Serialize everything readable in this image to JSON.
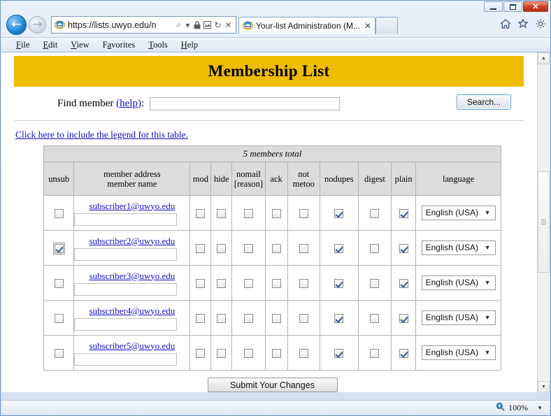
{
  "window": {
    "controls": {
      "minimize": "—",
      "maximize": "□",
      "close": "✕"
    }
  },
  "browser": {
    "back_icon": "←",
    "forward_icon": "→",
    "address": {
      "url": "https://lists.uwyo.edu/n",
      "favicon": "ie-logo-icon",
      "icons": [
        "search-icon",
        "dropdown-arrow-icon",
        "lock-icon",
        "compatibility-view-icon",
        "refresh-icon",
        "stop-icon"
      ],
      "search_glyph": "⌕",
      "dropdown_glyph": "▾",
      "lock_glyph": "🔒",
      "compat_glyph": "▩",
      "refresh_glyph": "↻",
      "stop_glyph": "✕"
    },
    "tabs": [
      {
        "title": "Your-list Administration (M...",
        "close_glyph": "✕",
        "active": true
      }
    ],
    "toolbar_icons": {
      "home_glyph": "⌂",
      "favorites_glyph": "★",
      "settings_glyph": "✿"
    },
    "menu": [
      {
        "accel": "F",
        "rest": "ile"
      },
      {
        "accel": "E",
        "rest": "dit"
      },
      {
        "accel": "V",
        "rest": "iew"
      },
      {
        "pre": "F",
        "accel": "a",
        "rest": "vorites"
      },
      {
        "pre": "",
        "accel": "T",
        "rest": "ools"
      },
      {
        "accel": "H",
        "rest": "elp"
      }
    ],
    "menu_labels": [
      "File",
      "Edit",
      "View",
      "Favorites",
      "Tools",
      "Help"
    ],
    "scrollbar": {
      "up_glyph": "▲",
      "down_glyph": "▼"
    },
    "status": {
      "zoom_level": "100%",
      "zoom_icon": "search-plus-icon",
      "zoom_glyph": "⊕",
      "caret": "▼"
    }
  },
  "page": {
    "banner_title": "Membership List",
    "banner_color": "#F0BC00",
    "find": {
      "label_prefix": "Find member ",
      "help_link": "(help)",
      "label_suffix": ":",
      "input_value": "",
      "search_button": "Search..."
    },
    "legend_link": "Click here to include the legend for this table.",
    "table": {
      "total_text": "5 members total",
      "headers": {
        "unsub": "unsub",
        "member_address_line1": "member address",
        "member_address_line2": "member name",
        "mod": "mod",
        "hide": "hide",
        "nomail_line1": "nomail",
        "nomail_line2": "[reason]",
        "ack": "ack",
        "metoo_line1": "not",
        "metoo_line2": "metoo",
        "nodupes": "nodupes",
        "digest": "digest",
        "plain": "plain",
        "language": "language"
      },
      "rows": [
        {
          "address": "subscriber1@uwyo.edu",
          "name": "",
          "unsub": false,
          "unsub_focus": false,
          "mod": false,
          "hide": false,
          "nomail": false,
          "ack": false,
          "metoo": false,
          "nodupes": true,
          "digest": false,
          "plain": true,
          "language": "English (USA)"
        },
        {
          "address": "subscriber2@uwyo.edu",
          "name": "",
          "unsub": true,
          "unsub_focus": true,
          "mod": false,
          "hide": false,
          "nomail": false,
          "ack": false,
          "metoo": false,
          "nodupes": true,
          "digest": false,
          "plain": true,
          "language": "English (USA)"
        },
        {
          "address": "subscriber3@uwyo.edu",
          "name": "",
          "unsub": false,
          "unsub_focus": false,
          "mod": false,
          "hide": false,
          "nomail": false,
          "ack": false,
          "metoo": false,
          "nodupes": true,
          "digest": false,
          "plain": true,
          "language": "English (USA)"
        },
        {
          "address": "subscriber4@uwyo.edu",
          "name": "",
          "unsub": false,
          "unsub_focus": false,
          "mod": false,
          "hide": false,
          "nomail": false,
          "ack": false,
          "metoo": false,
          "nodupes": true,
          "digest": false,
          "plain": true,
          "language": "English (USA)"
        },
        {
          "address": "subscriber5@uwyo.edu",
          "name": "",
          "unsub": false,
          "unsub_focus": false,
          "mod": false,
          "hide": false,
          "nomail": false,
          "ack": false,
          "metoo": false,
          "nodupes": true,
          "digest": false,
          "plain": true,
          "language": "English (USA)"
        }
      ],
      "select_caret": "▼"
    },
    "submit_button": "Submit Your Changes"
  }
}
